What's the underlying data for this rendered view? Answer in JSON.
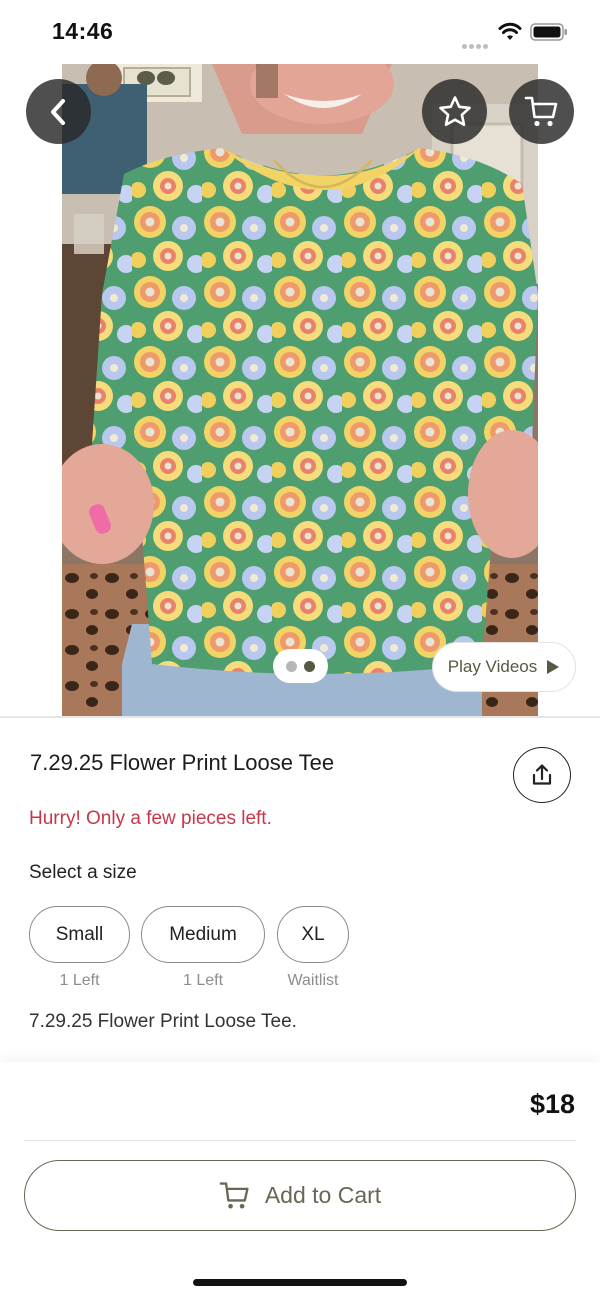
{
  "status_bar": {
    "time": "14:46",
    "icons": [
      "signal-dots-icon",
      "wifi-icon",
      "battery-icon"
    ]
  },
  "media": {
    "image_count": 2,
    "active_image": 2,
    "play_videos_label": "Play Videos",
    "nav": {
      "back_icon": "chevron-left-icon",
      "favorite_icon": "star-icon",
      "cart_icon": "cart-icon"
    }
  },
  "product": {
    "title": "7.29.25 Flower Print Loose Tee",
    "urgency_text": "Hurry! Only a few pieces left.",
    "size_prompt": "Select a size",
    "sizes": [
      {
        "label": "Small",
        "stock": "1 Left"
      },
      {
        "label": "Medium",
        "stock": "1 Left"
      },
      {
        "label": "XL",
        "stock": "Waitlist"
      }
    ],
    "description": "7.29.25 Flower Print Loose Tee."
  },
  "purchase": {
    "price": "$18",
    "add_to_cart_label": "Add to Cart"
  },
  "colors": {
    "urgency": "#c8364a",
    "accent": "#6a6654",
    "pager_active": "#555a42"
  }
}
